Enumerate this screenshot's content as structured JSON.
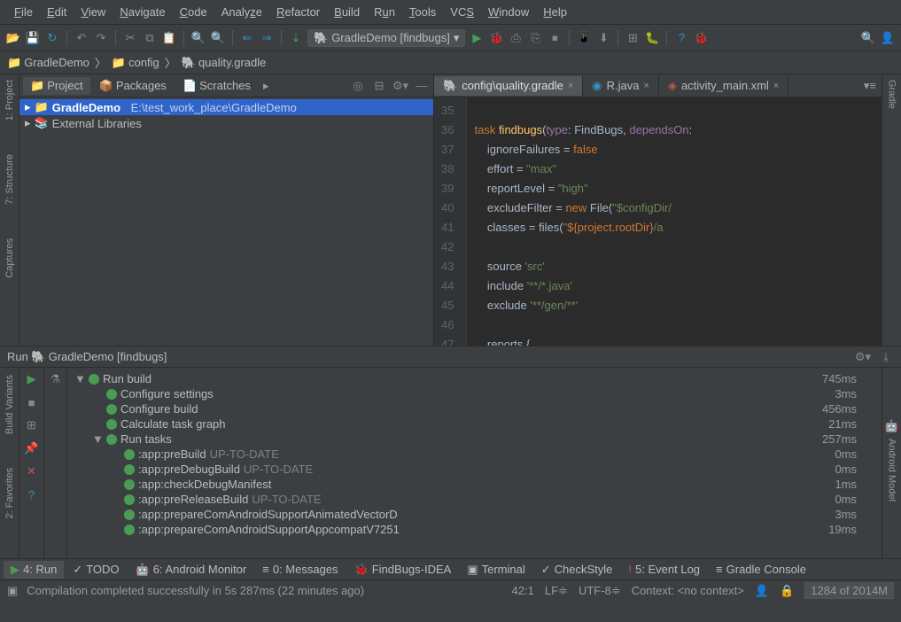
{
  "menu": {
    "file": "File",
    "edit": "Edit",
    "view": "View",
    "navigate": "Navigate",
    "code": "Code",
    "analyze": "Analyze",
    "refactor": "Refactor",
    "build": "Build",
    "run": "Run",
    "tools": "Tools",
    "vcs": "VCS",
    "window": "Window",
    "help": "Help"
  },
  "toolbar": {
    "runconfig": "GradleDemo [findbugs]"
  },
  "breadcrumb": {
    "root": "GradleDemo",
    "folder": "config",
    "file": "quality.gradle"
  },
  "left_tabs": {
    "project": "1: Project",
    "structure": "7: Structure",
    "captures": "Captures"
  },
  "right_tabs": {
    "gradle": "Gradle"
  },
  "project_tabs": {
    "project": "Project",
    "packages": "Packages",
    "scratches": "Scratches"
  },
  "project_tree": {
    "root": "GradleDemo",
    "root_path": "E:\\test_work_place\\GradleDemo",
    "ext": "External Libraries"
  },
  "editor_tabs": {
    "t1": "config\\quality.gradle",
    "t2": "R.java",
    "t3": "activity_main.xml"
  },
  "code": {
    "ln": [
      "35",
      "36",
      "37",
      "38",
      "39",
      "40",
      "41",
      "42",
      "43",
      "44",
      "45",
      "46",
      "47"
    ],
    "l36a": "task ",
    "l36b": "findbugs",
    "l36c": "(",
    "l36d": "type",
    "l36e": ": FindBugs, ",
    "l36f": "dependsOn",
    "l36g": ":",
    "l37a": "ignoreFailures ",
    "l37b": "= ",
    "l37c": "false",
    "l38a": "effort ",
    "l38b": "= ",
    "l38c": "\"max\"",
    "l39a": "reportLevel ",
    "l39b": "= ",
    "l39c": "\"high\"",
    "l40a": "excludeFilter ",
    "l40b": "= ",
    "l40c": "new ",
    "l40d": "File(",
    "l40e": "\"$configDir/",
    "l41a": "classes ",
    "l41b": "= files(",
    "l41c": "\"",
    "l41d": "${project.rootDir}",
    "l41e": "/a",
    "l43a": "source ",
    "l43b": "'src'",
    "l44a": "include ",
    "l44b": "'**/*.java'",
    "l45a": "exclude ",
    "l45b": "'**/gen/**'",
    "l47a": "reports ",
    "l47b": "{"
  },
  "run": {
    "header_label": "Run",
    "header_config": "GradleDemo [findbugs]",
    "rows": [
      {
        "indent": 0,
        "caret": "▼",
        "ok": true,
        "label": "Run build",
        "time": "745ms"
      },
      {
        "indent": 1,
        "ok": true,
        "label": "Configure settings",
        "time": "3ms"
      },
      {
        "indent": 1,
        "ok": true,
        "label": "Configure build",
        "time": "456ms"
      },
      {
        "indent": 1,
        "ok": true,
        "label": "Calculate task graph",
        "time": "21ms"
      },
      {
        "indent": 1,
        "caret": "▼",
        "ok": true,
        "label": "Run tasks",
        "time": "257ms"
      },
      {
        "indent": 2,
        "ok": true,
        "label": ":app:preBuild",
        "suffix": "UP-TO-DATE",
        "time": "0ms"
      },
      {
        "indent": 2,
        "ok": true,
        "label": ":app:preDebugBuild",
        "suffix": "UP-TO-DATE",
        "time": "0ms"
      },
      {
        "indent": 2,
        "ok": true,
        "label": ":app:checkDebugManifest",
        "time": "1ms"
      },
      {
        "indent": 2,
        "ok": true,
        "label": ":app:preReleaseBuild",
        "suffix": "UP-TO-DATE",
        "time": "0ms"
      },
      {
        "indent": 2,
        "ok": true,
        "label": ":app:prepareComAndroidSupportAnimatedVectorD",
        "time": "3ms"
      },
      {
        "indent": 2,
        "ok": true,
        "label": ":app:prepareComAndroidSupportAppcompatV7251",
        "time": "19ms"
      }
    ]
  },
  "left2": {
    "bv": "Build Variants",
    "fav": "2: Favorites"
  },
  "right2": {
    "am": "Android Model"
  },
  "bottom_tabs": {
    "run": "4: Run",
    "todo": "TODO",
    "am": "6: Android Monitor",
    "msg": "0: Messages",
    "fb": "FindBugs-IDEA",
    "term": "Terminal",
    "cs": "CheckStyle",
    "ev": "5: Event Log",
    "gc": "Gradle Console"
  },
  "status": {
    "msg": "Compilation completed successfully in 5s 287ms (22 minutes ago)",
    "pos": "42:1",
    "lf": "LF",
    "enc": "UTF-8",
    "ctx": "Context: <no context>",
    "mem": "1284 of 2014M"
  }
}
